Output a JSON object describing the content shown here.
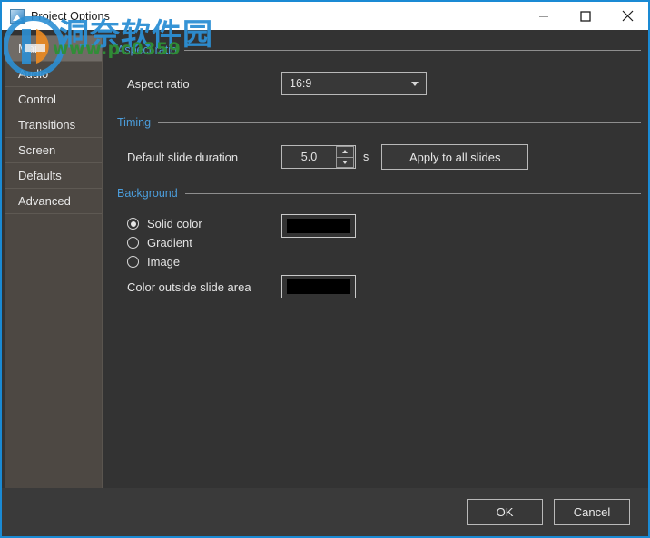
{
  "window": {
    "title": "Project Options",
    "icon": "app-icon",
    "accent_border": "#1a8ad4",
    "titlebar_bg": "#ffffff",
    "content_bg": "#333333",
    "sidebar_bg": "#4d4843",
    "section_title_color": "#4b9ddb",
    "controls": {
      "minimize": "minimize-icon",
      "maximize": "maximize-icon",
      "close": "close-icon"
    }
  },
  "sidebar": {
    "items": [
      {
        "label": "Main",
        "selected": true
      },
      {
        "label": "Audio",
        "selected": false
      },
      {
        "label": "Control",
        "selected": false
      },
      {
        "label": "Transitions",
        "selected": false
      },
      {
        "label": "Screen",
        "selected": false
      },
      {
        "label": "Defaults",
        "selected": false
      },
      {
        "label": "Advanced",
        "selected": false
      }
    ]
  },
  "main": {
    "aspect_section": {
      "title": "Aspect ratio",
      "label": "Aspect ratio",
      "value": "16:9",
      "options": [
        "16:9"
      ]
    },
    "timing_section": {
      "title": "Timing",
      "label": "Default slide duration",
      "value": "5.0",
      "unit": "s",
      "apply_button": "Apply to all slides"
    },
    "background_section": {
      "title": "Background",
      "radios": [
        {
          "label": "Solid color",
          "checked": true
        },
        {
          "label": "Gradient",
          "checked": false
        },
        {
          "label": "Image",
          "checked": false
        }
      ],
      "background_color": "#000000",
      "outside_label": "Color outside slide area",
      "outside_color": "#000000"
    }
  },
  "footer": {
    "ok_label": "OK",
    "cancel_label": "Cancel"
  },
  "watermark": {
    "chinese": "洞奈软件园",
    "url": "www.pc0359",
    "cn_color": "#2c8fd4",
    "url_color": "#2f8f36"
  }
}
